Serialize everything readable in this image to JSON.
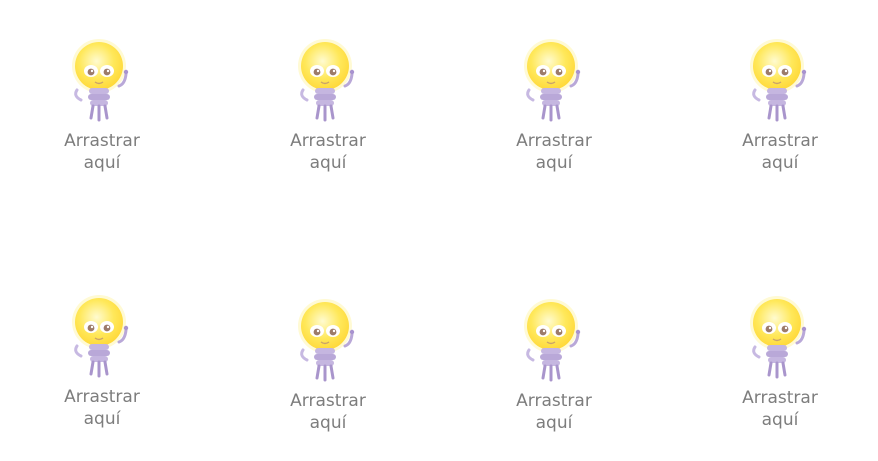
{
  "drop_zone_label": "Arrastrar aquí",
  "drop_zones": [
    {
      "label": "Arrastrar aquí",
      "icon": "lightbulb-mascot-icon"
    },
    {
      "label": "Arrastrar aquí",
      "icon": "lightbulb-mascot-icon"
    },
    {
      "label": "Arrastrar aquí",
      "icon": "lightbulb-mascot-icon"
    },
    {
      "label": "Arrastrar aquí",
      "icon": "lightbulb-mascot-icon"
    },
    {
      "label": "Arrastrar aquí",
      "icon": "lightbulb-mascot-icon"
    },
    {
      "label": "Arrastrar aquí",
      "icon": "lightbulb-mascot-icon"
    },
    {
      "label": "Arrastrar aquí",
      "icon": "lightbulb-mascot-icon"
    },
    {
      "label": "Arrastrar aquí",
      "icon": "lightbulb-mascot-icon"
    }
  ],
  "colors": {
    "bulb": "#ffe24a",
    "bulb_glow": "#fff6b0",
    "base": "#b9a8d8",
    "label": "#7d7d7d"
  }
}
